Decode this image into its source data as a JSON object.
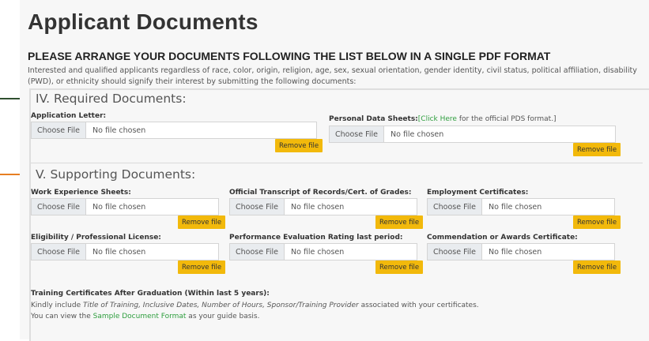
{
  "page": {
    "title": "Applicant Documents",
    "subtitle": "PLEASE ARRANGE YOUR DOCUMENTS FOLLOWING THE LIST BELOW IN A SINGLE PDF FORMAT",
    "intro": "Interested and qualified applicants regardless of race, color, origin, religion, age, sex, sexual orientation, gender identity, civil status, political affiliation, disability (PWD), or ethnicity should signify their interest by submitting the following documents:"
  },
  "colors": {
    "arrow_required": "#2f4f2f",
    "arrow_supporting": "#e67e22",
    "remove_button": "#f2b90b",
    "link": "#2e9e3e"
  },
  "common": {
    "choose_file": "Choose File",
    "no_file": "No file chosen",
    "remove_file": "Remove file"
  },
  "required": {
    "heading": "IV. Required Documents:",
    "application_letter": "Application Letter:",
    "pds_label": "Personal Data Sheets:",
    "pds_link": "[Click Here",
    "pds_suffix": " for the official PDS format.]"
  },
  "supporting": {
    "heading": "V. Supporting Documents:",
    "work_experience": "Work Experience Sheets:",
    "transcript": "Official Transcript of Records/Cert. of Grades:",
    "employment": "Employment Certificates:",
    "eligibility": "Eligibility / Professional License:",
    "performance": "Performance Evaluation Rating last period:",
    "commendation": "Commendation or Awards Certificate:"
  },
  "training": {
    "label": "Training Certificates After Graduation (Within last 5 years):",
    "line1_prefix": "Kindly include ",
    "line1_italic": "Title of Training, Inclusive Dates, Number of Hours, Sponsor/Training Provider",
    "line1_suffix": " associated with your certificates.",
    "line2_prefix": "You can view the ",
    "line2_link": "Sample Document Format",
    "line2_suffix": " as your guide basis."
  }
}
